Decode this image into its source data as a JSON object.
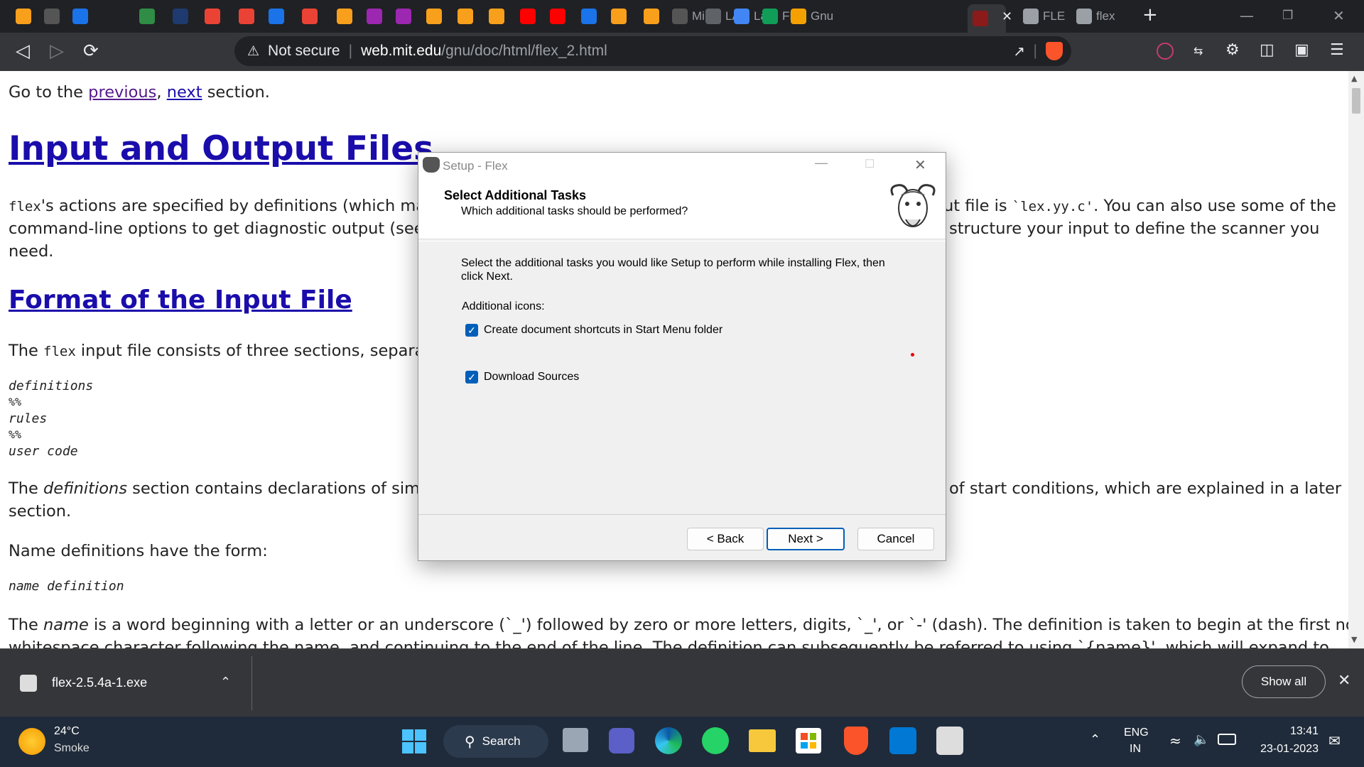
{
  "tabs": [
    {
      "favicon": "leetcode-icon",
      "label": "",
      "color": "#f89f1b"
    },
    {
      "favicon": "cc-icon",
      "label": "",
      "color": "#555"
    },
    {
      "favicon": "chart-icon",
      "label": "",
      "color": "#1a73e8"
    },
    {
      "favicon": "un",
      "label": "",
      "color": "#202124"
    },
    {
      "favicon": "gfg-icon",
      "label": "",
      "color": "#2f8d46"
    },
    {
      "favicon": "square-icon",
      "label": "",
      "color": "#1e3a6e"
    },
    {
      "favicon": "gmail-icon",
      "label": "",
      "color": "#ea4335"
    },
    {
      "favicon": "gmail-icon",
      "label": "",
      "color": "#ea4335"
    },
    {
      "favicon": "pb-icon",
      "label": "",
      "color": "#1a73e8"
    },
    {
      "favicon": "gmail-icon",
      "label": "",
      "color": "#ea4335"
    },
    {
      "favicon": "leetcode-icon",
      "label": "",
      "color": "#f89f1b"
    },
    {
      "favicon": "u-icon",
      "label": "",
      "color": "#9c27b0"
    },
    {
      "favicon": "u-icon",
      "label": "",
      "color": "#9c27b0"
    },
    {
      "favicon": "leetcode-icon",
      "label": "",
      "color": "#f89f1b"
    },
    {
      "favicon": "leetcode-icon",
      "label": "",
      "color": "#f89f1b"
    },
    {
      "favicon": "leetcode-icon",
      "label": "",
      "color": "#f89f1b"
    },
    {
      "favicon": "youtube-icon",
      "label": "",
      "color": "#ff0000"
    },
    {
      "favicon": "youtube-icon",
      "label": "",
      "color": "#ff0000"
    },
    {
      "favicon": "c-icon",
      "label": "",
      "color": "#1a73e8"
    },
    {
      "favicon": "leetcode-icon",
      "label": "",
      "color": "#f89f1b"
    },
    {
      "favicon": "leetcode-icon",
      "label": "",
      "color": "#f89f1b"
    },
    {
      "favicon": "cc-icon",
      "label": "Min",
      "color": "#555"
    },
    {
      "favicon": "person-icon",
      "label": "LAB",
      "color": "#5f6368"
    },
    {
      "favicon": "docs-icon",
      "label": "Lab",
      "color": "#4285f4"
    },
    {
      "favicon": "drive-icon",
      "label": "FLE",
      "color": "#0f9d58"
    },
    {
      "favicon": "diamond-icon",
      "label": "Gnu",
      "color": "#f4a100"
    },
    {
      "favicon": "flex-icon",
      "label": "",
      "color": "#8b1a1a"
    },
    {
      "favicon": "globe-icon",
      "label": "FLE",
      "color": "#9aa0a6"
    },
    {
      "favicon": "globe-icon",
      "label": "flex",
      "color": "#9aa0a6"
    }
  ],
  "address": {
    "security": "Not secure",
    "domain": "web.mit.edu",
    "path": "/gnu/doc/html/flex_2.html"
  },
  "page": {
    "nav_prefix": "Go to the ",
    "nav_previous": "previous",
    "nav_sep": ", ",
    "nav_next": "next",
    "nav_suffix": " section.",
    "h1": "Input and Output Files",
    "p1_code": "flex",
    "p1_a": "'s actions are specified by definitions (which may in",
    "p1_b": "ut file is ",
    "p1_code2": "`lex.yy.c'",
    "p1_c": ". You can also use some of the",
    "p1_line2a": "command-line options to get diagnostic output (see se",
    "p1_line2b": " structure your input to define the scanner you",
    "p1_line3": "need.",
    "h2": "Format of the Input File",
    "p2_a": "The ",
    "p2_code": "flex",
    "p2_b": " input file consists of three sections, separated",
    "code_lines": [
      "definitions",
      "%%",
      "rules",
      "%%",
      "user code"
    ],
    "p3_a": "The ",
    "p3_em": "definitions",
    "p3_b": " section contains declarations of simple",
    "p3_c": " of start conditions, which are explained in a later",
    "p3_line2": "section.",
    "p4": "Name definitions have the form:",
    "code2": "name definition",
    "p5_a": "The ",
    "p5_em": "name",
    "p5_b": " is a word beginning with a letter or an underscore (`_') followed by zero or more letters, digits, `_', or `-' (dash). The definition is taken to begin at the first non-",
    "p5_line2": "whitespace character following the name, and continuing to the end of the line. The definition can subsequently be referred to using `{name}', which will expand to"
  },
  "dialog": {
    "title": "Setup - Flex",
    "heading": "Select Additional Tasks",
    "subheading": "Which additional tasks should be performed?",
    "instruction": "Select the additional tasks you would like Setup to perform while installing Flex, then click Next.",
    "group_label": "Additional icons:",
    "task1": "Create document shortcuts in Start Menu folder",
    "task2": "Download Sources",
    "back": "< Back",
    "next": "Next >",
    "cancel": "Cancel"
  },
  "download": {
    "filename": "flex-2.5.4a-1.exe",
    "show_all": "Show all"
  },
  "taskbar": {
    "weather_temp": "24°C",
    "weather_desc": "Smoke",
    "search": "Search",
    "lang1": "ENG",
    "lang2": "IN",
    "time": "13:41",
    "date": "23-01-2023"
  }
}
